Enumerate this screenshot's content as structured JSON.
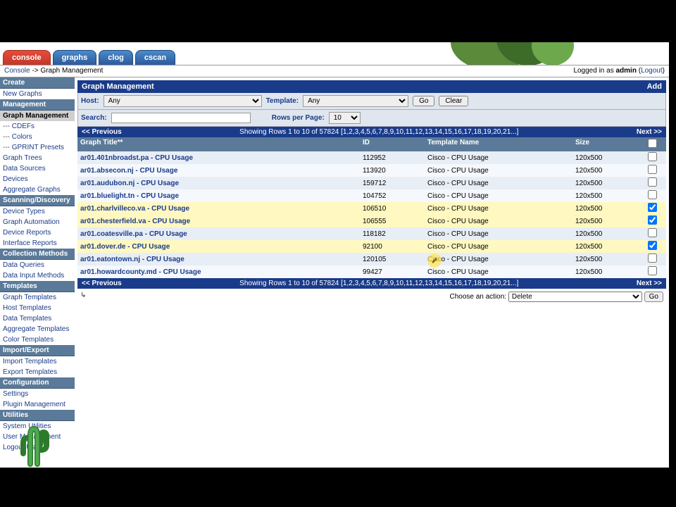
{
  "tabs": [
    "console",
    "graphs",
    "clog",
    "cscan"
  ],
  "active_tab": 0,
  "breadcrumb": {
    "root": "Console",
    "sep": " -> ",
    "page": "Graph Management"
  },
  "login": {
    "prefix": "Logged in as ",
    "user": "admin",
    "logout": "Logout"
  },
  "sidebar": [
    {
      "type": "header",
      "label": "Create"
    },
    {
      "type": "item",
      "label": "New Graphs"
    },
    {
      "type": "header",
      "label": "Management"
    },
    {
      "type": "item",
      "label": "Graph Management",
      "selected": true
    },
    {
      "type": "item",
      "label": "CDEFs",
      "indent": true
    },
    {
      "type": "item",
      "label": "Colors",
      "indent": true
    },
    {
      "type": "item",
      "label": "GPRINT Presets",
      "indent": true
    },
    {
      "type": "item",
      "label": "Graph Trees"
    },
    {
      "type": "item",
      "label": "Data Sources"
    },
    {
      "type": "item",
      "label": "Devices"
    },
    {
      "type": "item",
      "label": "Aggregate Graphs"
    },
    {
      "type": "header",
      "label": "Scanning/Discovery"
    },
    {
      "type": "item",
      "label": "Device Types"
    },
    {
      "type": "item",
      "label": "Graph Automation"
    },
    {
      "type": "item",
      "label": "Device Reports"
    },
    {
      "type": "item",
      "label": "Interface Reports"
    },
    {
      "type": "header",
      "label": "Collection Methods"
    },
    {
      "type": "item",
      "label": "Data Queries"
    },
    {
      "type": "item",
      "label": "Data Input Methods"
    },
    {
      "type": "header",
      "label": "Templates"
    },
    {
      "type": "item",
      "label": "Graph Templates"
    },
    {
      "type": "item",
      "label": "Host Templates"
    },
    {
      "type": "item",
      "label": "Data Templates"
    },
    {
      "type": "item",
      "label": "Aggregate Templates"
    },
    {
      "type": "item",
      "label": "Color Templates"
    },
    {
      "type": "header",
      "label": "Import/Export"
    },
    {
      "type": "item",
      "label": "Import Templates"
    },
    {
      "type": "item",
      "label": "Export Templates"
    },
    {
      "type": "header",
      "label": "Configuration"
    },
    {
      "type": "item",
      "label": "Settings"
    },
    {
      "type": "item",
      "label": "Plugin Management"
    },
    {
      "type": "header",
      "label": "Utilities"
    },
    {
      "type": "item",
      "label": "System Utilities"
    },
    {
      "type": "item",
      "label": "User Management"
    },
    {
      "type": "item",
      "label": "Logout User"
    }
  ],
  "panel": {
    "title": "Graph Management",
    "add": "Add"
  },
  "filters": {
    "host_label": "Host:",
    "host_value": "Any",
    "template_label": "Template:",
    "template_value": "Any",
    "go": "Go",
    "clear": "Clear",
    "search_label": "Search:",
    "search_value": "",
    "rows_label": "Rows per Page:",
    "rows_value": "10"
  },
  "pager": {
    "prev": "<< Previous",
    "next": "Next >>",
    "summary": "Showing Rows 1 to 10 of 57824 [1,2,3,4,5,6,7,8,9,10,11,12,13,14,15,16,17,18,19,20,21...]"
  },
  "columns": {
    "title": "Graph Title**",
    "id": "ID",
    "template": "Template Name",
    "size": "Size"
  },
  "rows": [
    {
      "title": "ar01.401nbroadst.pa - CPU Usage",
      "id": "112952",
      "template": "Cisco - CPU Usage",
      "size": "120x500",
      "selected": false
    },
    {
      "title": "ar01.absecon.nj - CPU Usage",
      "id": "113920",
      "template": "Cisco - CPU Usage",
      "size": "120x500",
      "selected": false
    },
    {
      "title": "ar01.audubon.nj - CPU Usage",
      "id": "159712",
      "template": "Cisco - CPU Usage",
      "size": "120x500",
      "selected": false
    },
    {
      "title": "ar01.bluelight.tn - CPU Usage",
      "id": "104752",
      "template": "Cisco - CPU Usage",
      "size": "120x500",
      "selected": false
    },
    {
      "title": "ar01.charlvilleco.va - CPU Usage",
      "id": "106510",
      "template": "Cisco - CPU Usage",
      "size": "120x500",
      "selected": true
    },
    {
      "title": "ar01.chesterfield.va - CPU Usage",
      "id": "106555",
      "template": "Cisco - CPU Usage",
      "size": "120x500",
      "selected": true
    },
    {
      "title": "ar01.coatesville.pa - CPU Usage",
      "id": "118182",
      "template": "Cisco - CPU Usage",
      "size": "120x500",
      "selected": false
    },
    {
      "title": "ar01.dover.de - CPU Usage",
      "id": "92100",
      "template": "Cisco - CPU Usage",
      "size": "120x500",
      "selected": true
    },
    {
      "title": "ar01.eatontown.nj - CPU Usage",
      "id": "120105",
      "template": "Cisco - CPU Usage",
      "size": "120x500",
      "selected": false
    },
    {
      "title": "ar01.howardcounty.md - CPU Usage",
      "id": "99427",
      "template": "Cisco - CPU Usage",
      "size": "120x500",
      "selected": false
    }
  ],
  "action": {
    "label": "Choose an action:",
    "value": "Delete",
    "go": "Go"
  }
}
